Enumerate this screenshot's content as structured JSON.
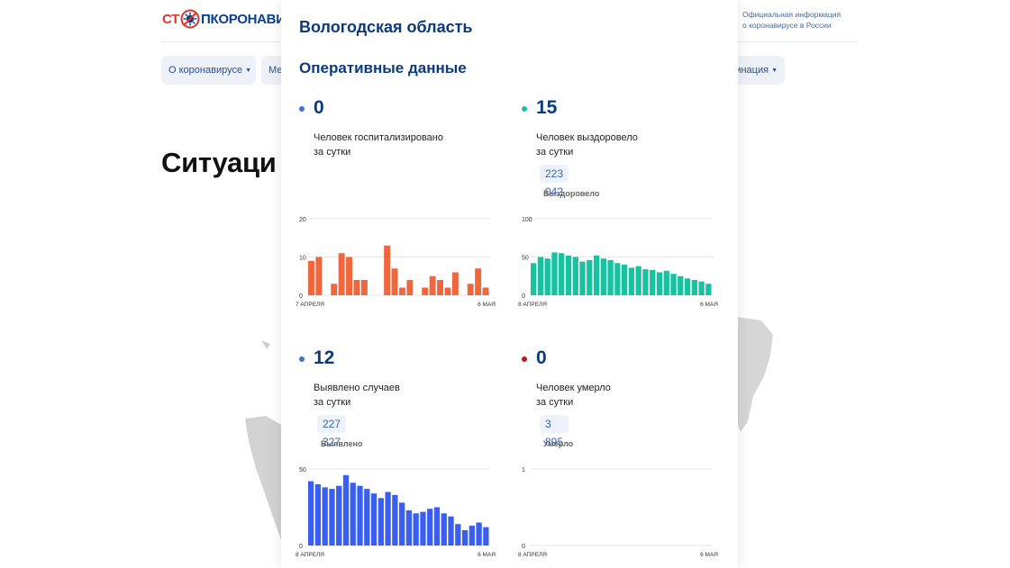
{
  "header": {
    "logo_left": "СТ",
    "logo_right": "ПКОРОНАВИ",
    "info_line1": "Официальная информация",
    "info_line2": "о коронавирусе в России"
  },
  "nav": [
    {
      "label": "О коронавирусе",
      "has_caret": true
    },
    {
      "label": "Ме"
    },
    {
      "label": "инация",
      "has_caret": true
    }
  ],
  "page_heading": "Ситуаци",
  "popup": {
    "region": "Вологодская область",
    "section": "Оперативные данные",
    "stats": {
      "hospitalized": {
        "value": "0",
        "desc_line1": "Человек госпитализировано",
        "desc_line2": "за сутки",
        "color": "#3f6fd8"
      },
      "recovered": {
        "value": "15",
        "desc_line1": "Человек выздоровело",
        "desc_line2": "за сутки",
        "total": "223 042",
        "total_label": "Выздоровело",
        "color": "#17c2a0"
      },
      "cases": {
        "value": "12",
        "desc_line1": "Выявлено случаев",
        "desc_line2": "за сутки",
        "total": "227 327",
        "total_label": "Выявлено",
        "color": "#3f6fd8"
      },
      "deaths": {
        "value": "0",
        "desc_line1": "Человек умерло",
        "desc_line2": "за сутки",
        "total": "3 895",
        "total_label": "Умерло",
        "color": "#b71c1c"
      }
    }
  },
  "chart_data": [
    {
      "type": "bar",
      "id": "hospitalized",
      "color": "#f0663d",
      "ylim": [
        0,
        20
      ],
      "yticks": [
        "0",
        "10",
        "20"
      ],
      "x_start_label": "7 АПРЕЛЯ",
      "x_end_label": "6 МАЯ",
      "values": [
        9,
        10,
        0,
        3,
        11,
        10,
        4,
        4,
        0,
        0,
        13,
        7,
        2,
        4,
        0,
        2,
        5,
        4,
        2,
        6,
        0,
        3,
        7,
        2
      ]
    },
    {
      "type": "bar",
      "id": "recovered",
      "color": "#17c2a0",
      "ylim": [
        0,
        100
      ],
      "yticks": [
        "0",
        "50",
        "100"
      ],
      "x_start_label": "8 АПРЕЛЯ",
      "x_end_label": "6 МАЯ",
      "values": [
        42,
        50,
        48,
        56,
        55,
        52,
        50,
        44,
        46,
        52,
        48,
        46,
        42,
        40,
        36,
        38,
        34,
        33,
        30,
        32,
        28,
        25,
        22,
        20,
        18,
        15
      ]
    },
    {
      "type": "bar",
      "id": "cases",
      "color": "#3a5ef2",
      "ylim": [
        0,
        50
      ],
      "yticks": [
        "0",
        "50"
      ],
      "x_start_label": "8 АПРЕЛЯ",
      "x_end_label": "6 МАЯ",
      "values": [
        42,
        40,
        38,
        37,
        39,
        46,
        41,
        39,
        37,
        34,
        31,
        35,
        33,
        28,
        23,
        21,
        22,
        24,
        25,
        21,
        19,
        14,
        10,
        13,
        15,
        12
      ]
    },
    {
      "type": "bar",
      "id": "deaths",
      "color": "#b71c1c",
      "ylim": [
        0,
        1
      ],
      "yticks": [
        "0",
        "1"
      ],
      "x_start_label": "8 АПРЕЛЯ",
      "x_end_label": "6 МАЯ",
      "values": []
    }
  ]
}
